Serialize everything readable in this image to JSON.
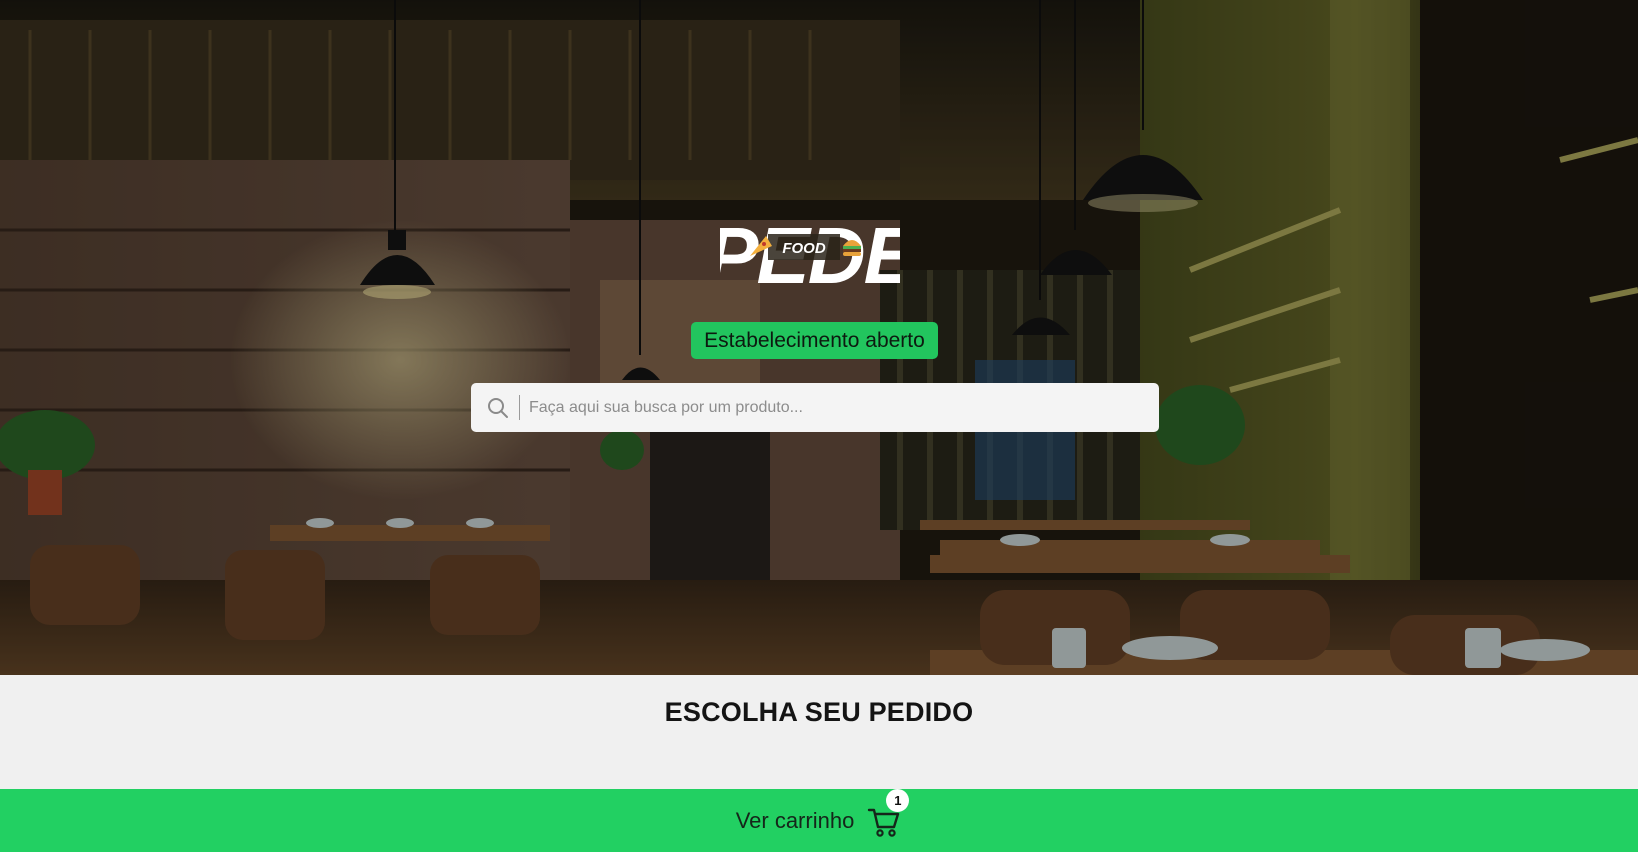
{
  "brand": {
    "logo_main": "PEDE",
    "logo_sub": "FOOD"
  },
  "status": {
    "label": "Estabelecimento aberto",
    "color": "#22c55e"
  },
  "search": {
    "placeholder": "Faça aqui sua busca por um produto...",
    "value": "",
    "icon": "search-icon"
  },
  "section": {
    "title": "ESCOLHA SEU PEDIDO"
  },
  "cart": {
    "label": "Ver carrinho",
    "count": "1",
    "icon": "cart-icon",
    "bar_color": "#22d062"
  }
}
